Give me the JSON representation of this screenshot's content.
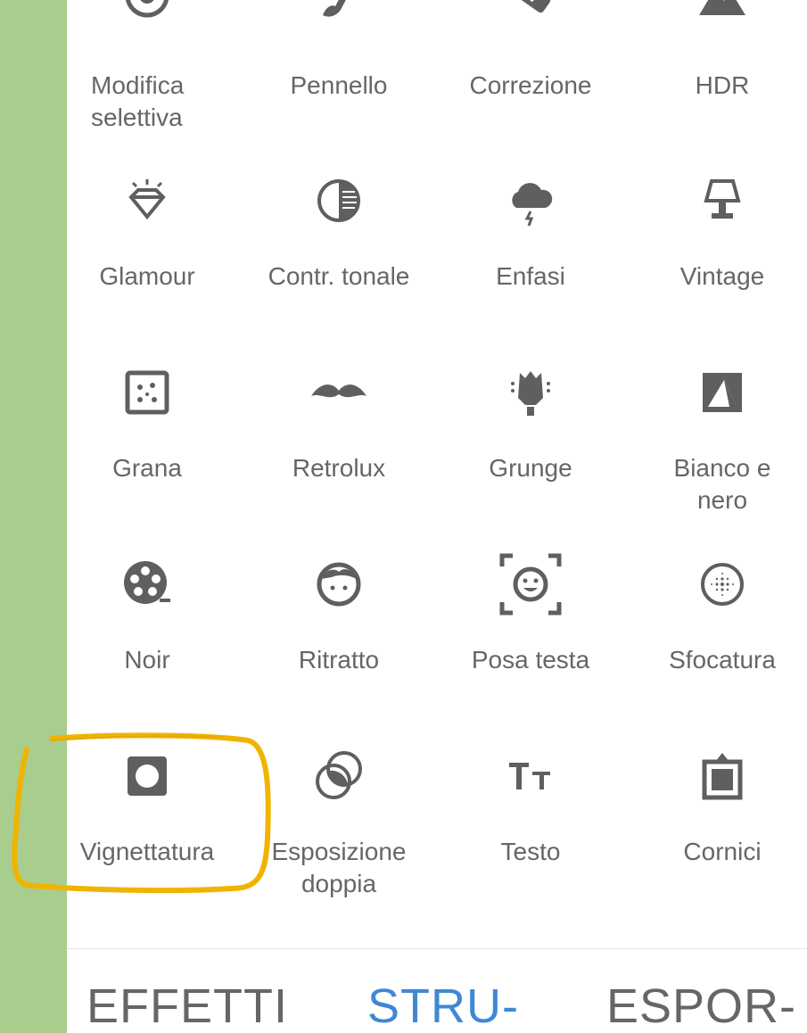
{
  "tools": [
    {
      "label": "Modifica\nselettiva",
      "icon": "selective-icon"
    },
    {
      "label": "Pennello",
      "icon": "brush-icon"
    },
    {
      "label": "Correzione",
      "icon": "healing-icon"
    },
    {
      "label": "HDR",
      "icon": "hdr-icon"
    },
    {
      "label": "Glamour",
      "icon": "glamour-icon"
    },
    {
      "label": "Contr. tonale",
      "icon": "tonal-contrast-icon"
    },
    {
      "label": "Enfasi",
      "icon": "drama-icon"
    },
    {
      "label": "Vintage",
      "icon": "vintage-lamp-icon"
    },
    {
      "label": "Grana",
      "icon": "grainy-icon"
    },
    {
      "label": "Retrolux",
      "icon": "mustache-icon"
    },
    {
      "label": "Grunge",
      "icon": "grunge-icon"
    },
    {
      "label": "Bianco e\nnero",
      "icon": "black-white-icon"
    },
    {
      "label": "Noir",
      "icon": "film-reel-icon"
    },
    {
      "label": "Ritratto",
      "icon": "portrait-face-icon"
    },
    {
      "label": "Posa testa",
      "icon": "head-pose-icon"
    },
    {
      "label": "Sfocatura",
      "icon": "blur-icon"
    },
    {
      "label": "Vignettatura",
      "icon": "vignette-icon"
    },
    {
      "label": "Esposizione\ndoppia",
      "icon": "double-exposure-icon"
    },
    {
      "label": "Testo",
      "icon": "text-icon"
    },
    {
      "label": "Cornici",
      "icon": "frames-icon"
    }
  ],
  "tabs": [
    {
      "label": "EFFETTI"
    },
    {
      "label": "STRU-"
    },
    {
      "label": "ESPOR-"
    }
  ],
  "colors": {
    "accent": "#3f88d4",
    "icon": "#5f5f5f",
    "label": "#666666",
    "highlight": "#f0b400",
    "background": "#a9cd8d"
  }
}
